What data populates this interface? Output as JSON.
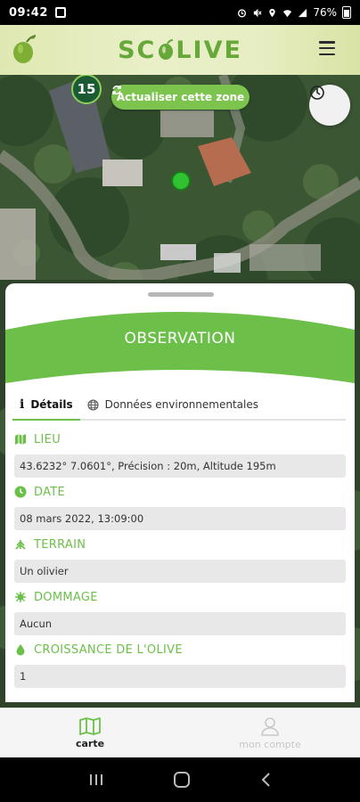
{
  "status_bar": {
    "time": "09:42",
    "battery": "76%"
  },
  "header": {
    "brand": {
      "left": "SC",
      "right": "LIVE"
    }
  },
  "map": {
    "zoom_badge": "15",
    "refresh_label": "Actualiser cette zone"
  },
  "panel": {
    "title": "OBSERVATION",
    "tabs": [
      {
        "label": "Détails",
        "icon": "info-icon",
        "active": true
      },
      {
        "label": "Données environnementales",
        "icon": "globe-icon",
        "active": false
      }
    ],
    "fields": {
      "lieu": {
        "label": "LIEU",
        "value": "43.6232° 7.0601°, Précision : 20m, Altitude 195m",
        "icon": "map-icon"
      },
      "date": {
        "label": "DATE",
        "value": "08 mars 2022, 13:09:00",
        "icon": "clock-icon"
      },
      "terrain": {
        "label": "TERRAIN",
        "value": "Un olivier",
        "icon": "terrain-icon"
      },
      "dommage": {
        "label": "DOMMAGE",
        "value": "Aucun",
        "icon": "bug-icon"
      },
      "croissance": {
        "label": "CROISSANCE DE L'OLIVE",
        "value": "1",
        "icon": "olive-drop-icon"
      }
    }
  },
  "bottom_nav": {
    "carte": {
      "label": "carte",
      "active": true
    },
    "compte": {
      "label": "mon compte",
      "active": false
    }
  },
  "colors": {
    "accent": "#6cc04a",
    "brand": "#67a83a",
    "badge": "#1c5a33"
  }
}
